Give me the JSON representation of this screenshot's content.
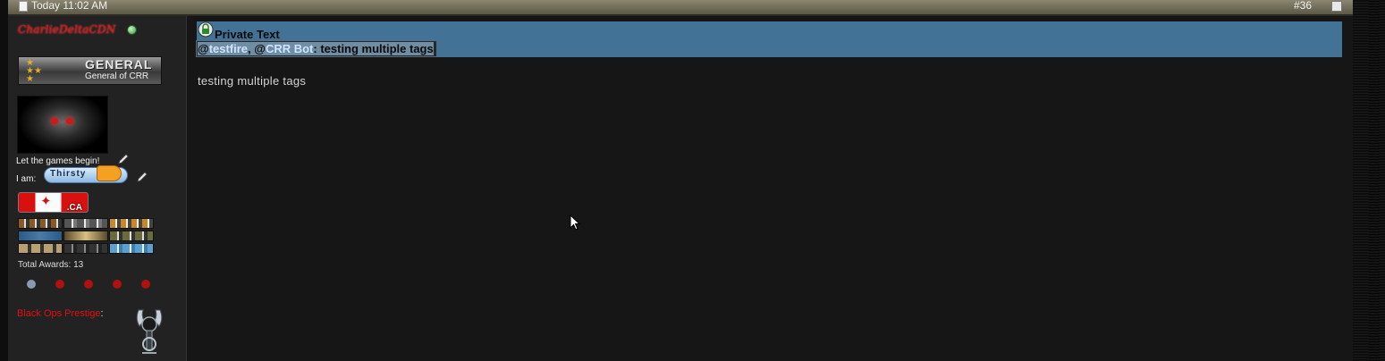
{
  "post": {
    "date": "Today 11:02 AM",
    "number": "#36"
  },
  "user": {
    "username": "CharlieDeltaCDN",
    "rank_title": "GENERAL",
    "rank_subtitle": "General of CRR",
    "status_message": "Let the games begin!",
    "mood_label": "I am:",
    "mood_value": "Thirsty",
    "country_code": ".CA",
    "total_awards_label": "Total Awards:",
    "total_awards_count": "13",
    "prestige_label": "Black Ops Prestige",
    "prestige_colon": ":"
  },
  "private_text": {
    "title": "Private Text",
    "at1": "@",
    "mention1": "testfire",
    "sep": ", @",
    "mention2": "CRR Bot",
    "suffix": ": testing multiple tags"
  },
  "message": "testing multiple tags",
  "colors": {
    "header_bar": "#6e6b58",
    "private_box": "#427296",
    "username": "#e01010"
  }
}
